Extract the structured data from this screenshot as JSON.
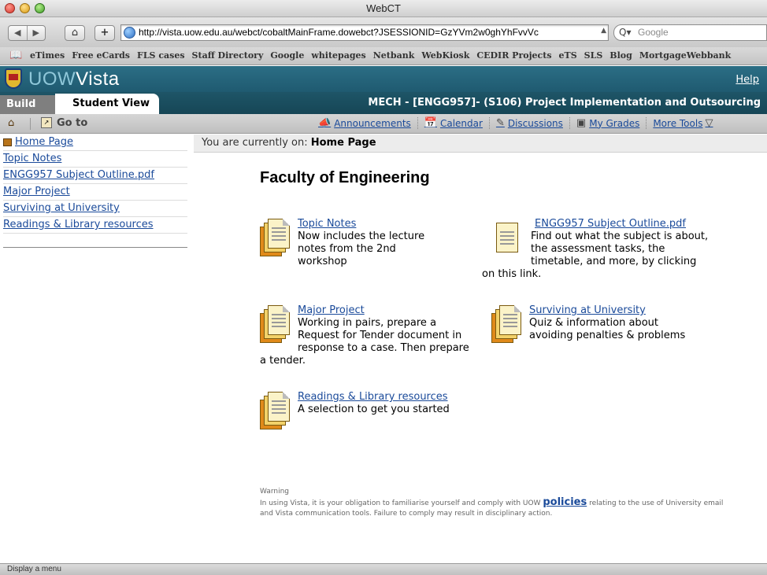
{
  "window": {
    "title": "WebCT"
  },
  "browser": {
    "url": "http://vista.uow.edu.au/webct/cobaltMainFrame.dowebct?JSESSIONID=GzYVm2w0ghYhFvvVc",
    "search_placeholder": "Google",
    "bookmarks": [
      "eTimes",
      "Free eCards",
      "FLS cases",
      "Staff Directory",
      "Google",
      "whitepages",
      "Netbank",
      "WebKiosk",
      "CEDIR Projects",
      "eTS",
      "SLS",
      "Blog",
      "MortgageWebbank"
    ]
  },
  "header": {
    "logo_uow": "UOW",
    "logo_vista": "Vista",
    "help": "Help"
  },
  "tabs": {
    "build": "Build",
    "student_view": "Student View"
  },
  "course_title": "MECH - [ENGG957]- (S106) Project Implementation and Outsourcing",
  "action_bar": {
    "goto": "Go to",
    "links": [
      "Announcements",
      "Calendar",
      "Discussions",
      "My Grades",
      "More Tools"
    ]
  },
  "left_nav": [
    "Home Page",
    "Topic Notes",
    "ENGG957 Subject Outline.pdf",
    "Major Project",
    "Surviving at University",
    "Readings & Library resources"
  ],
  "breadcrumb": {
    "prefix": "You are currently on:",
    "current": "Home Page"
  },
  "main": {
    "heading": "Faculty of Engineering",
    "items": [
      {
        "title": "Topic Notes",
        "desc": "Now includes the lecture notes from the 2nd workshop"
      },
      {
        "title": "ENGG957 Subject Outline.pdf",
        "desc": "Find out what the subject is about, the assessment tasks, the timetable, and more, by clicking on this link."
      },
      {
        "title": "Major Project",
        "desc": "Working in pairs, prepare a Request for Tender document in response to a case. Then prepare a tender."
      },
      {
        "title": "Surviving at University",
        "desc": "Quiz & information about avoiding penalties & problems"
      },
      {
        "title": "Readings & Library resources",
        "desc": "A selection to get you started"
      }
    ],
    "warning_title": "Warning",
    "warning_text_1": "In using Vista, it is your obligation to familiarise yourself and comply with UOW",
    "warning_link": "policies",
    "warning_text_2": "relating to the use of University email and Vista communication tools. Failure to comply may result in disciplinary action."
  },
  "status_bar": "Display a menu"
}
